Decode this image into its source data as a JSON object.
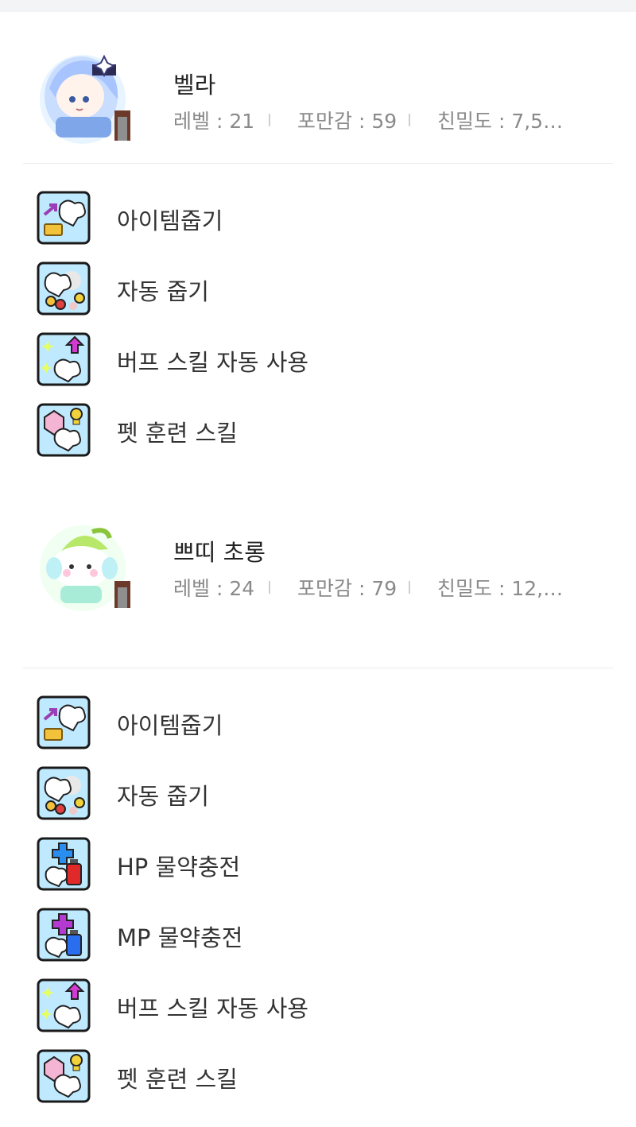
{
  "pets": [
    {
      "name": "벨라",
      "avatar_icon": "pet-bella-avatar-icon",
      "stats": {
        "level": "레벨 : 21",
        "fullness": "포만감 : 59",
        "intimacy": "친밀도 : 7,5…"
      },
      "skills": [
        {
          "label": "아이템줍기",
          "icon": "item-pickup-skill-icon"
        },
        {
          "label": "자동 줍기",
          "icon": "auto-pickup-skill-icon"
        },
        {
          "label": "버프 스킬 자동 사용",
          "icon": "auto-buff-skill-icon"
        },
        {
          "label": "펫 훈련 스킬",
          "icon": "pet-training-skill-icon"
        }
      ]
    },
    {
      "name": "쁘띠 초롱",
      "avatar_icon": "pet-chorong-avatar-icon",
      "stats": {
        "level": "레벨 : 24",
        "fullness": "포만감 : 79",
        "intimacy": "친밀도 : 12,…"
      },
      "skills": [
        {
          "label": "아이템줍기",
          "icon": "item-pickup-skill-icon"
        },
        {
          "label": "자동 줍기",
          "icon": "auto-pickup-skill-icon"
        },
        {
          "label": "HP 물약충전",
          "icon": "hp-potion-skill-icon"
        },
        {
          "label": "MP 물약충전",
          "icon": "mp-potion-skill-icon"
        },
        {
          "label": "버프 스킬 자동 사용",
          "icon": "auto-buff-skill-icon"
        },
        {
          "label": "펫 훈련 스킬",
          "icon": "pet-training-skill-icon"
        }
      ]
    }
  ],
  "colors": {
    "icon_frame": "#1a1a1a",
    "icon_bg": "#bfe9ff",
    "stat_text": "#8a8a8a",
    "divider": "#ececec"
  }
}
